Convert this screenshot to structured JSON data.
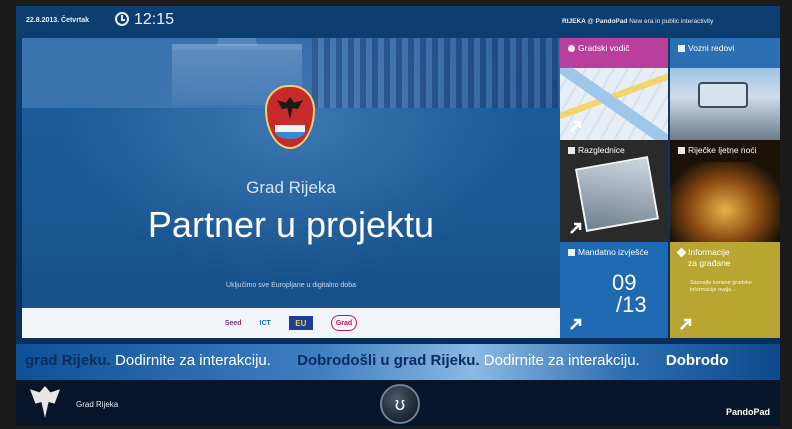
{
  "topbar": {
    "date": "22.8.2013. Četvrtak",
    "time": "12:15",
    "brand_bold": "RIJEKA @ PandoPad",
    "brand_tagline": "New era in public interactivity"
  },
  "hero": {
    "subtitle": "Grad Rijeka",
    "title": "Partner u projektu",
    "tagline": "Uključimo sve Europljane u digitalno doba"
  },
  "sponsors": [
    "Seed",
    "ICT",
    "EU",
    "Grad"
  ],
  "tiles": [
    {
      "label": "Gradski vodič",
      "color": "#b93f9c",
      "icon": "map-pin-icon"
    },
    {
      "label": "Vozni redovi",
      "color": "#2d6fb3",
      "icon": "bus-icon"
    },
    {
      "label": "Razglednice",
      "color": "#2a2a2a",
      "icon": "image-icon"
    },
    {
      "label": "Riječke ljetne noći",
      "color": "#1a1206",
      "icon": "theater-icon"
    },
    {
      "label": "Mandatno izvješće",
      "color": "#1f6ab3",
      "icon": "document-icon",
      "big_top": "09",
      "big_bottom": "13"
    },
    {
      "label_line1": "Informacije",
      "label_line2": "za građane",
      "color": "#b9a532",
      "icon": "info-icon",
      "desc_line1": "Saznajte korisne gradske",
      "desc_line2": "informacije ovdje..."
    }
  ],
  "ticker": {
    "seg1_bold": "grad Rijeku.",
    "seg1_rest": "Dodirnite za interakciju.",
    "seg2_bold": "Dobrodošli u grad Rijeku.",
    "seg2_rest": "Dodirnite za interakciju.",
    "seg3_bold": "Dobrodo"
  },
  "bottombar": {
    "name": "Grad Rijeka",
    "center_glyph": "ʊ",
    "brand": "PandoPad"
  }
}
